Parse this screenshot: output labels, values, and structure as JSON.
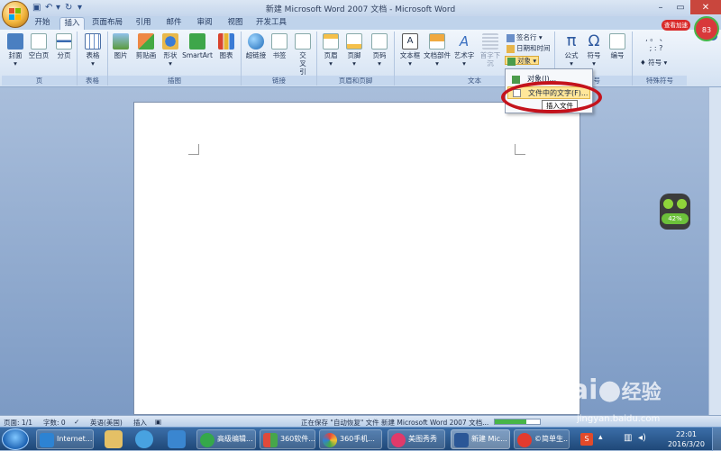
{
  "titlebar": {
    "title": "新建 Microsoft Word 2007 文档 - Microsoft Word",
    "badge_label": "查看加速",
    "badge_count": "83"
  },
  "tabs": [
    "开始",
    "插入",
    "页面布局",
    "引用",
    "邮件",
    "审阅",
    "视图",
    "开发工具"
  ],
  "ribbon": {
    "groups": {
      "pages": "页",
      "tables": "表格",
      "illustrations": "插图",
      "links": "链接",
      "header_footer": "页眉和页脚",
      "text": "文本",
      "symbols": "符号",
      "special": "特殊符号"
    },
    "buttons": {
      "cover": "封面",
      "blank": "空白页",
      "break": "分页",
      "table": "表格",
      "picture": "图片",
      "clipart": "剪贴画",
      "shapes": "形状",
      "smartart": "SmartArt",
      "chart": "图表",
      "hyperlink": "超链接",
      "bookmark": "书签",
      "crossref": "交叉引用",
      "header": "页眉",
      "footer": "页脚",
      "pagenum": "页码",
      "textbox": "文本框",
      "quickparts": "文档部件",
      "wordart": "艺术字",
      "dropcap": "首字下沉",
      "signature": "签名行",
      "datetime": "日期和时间",
      "object": "对象",
      "equation": "公式",
      "symbol": "符号",
      "number": "编号",
      "special_symbol": "符号"
    }
  },
  "object_menu": {
    "items": [
      "对象(J)...",
      "文件中的文字(F)..."
    ],
    "tooltip": "插入文件"
  },
  "mascot_percent": "42%",
  "statusbar": {
    "page": "页面: 1/1",
    "words": "字数: 0",
    "language": "英语(美国)",
    "mode": "插入",
    "saving": "正在保存 \"自动恢复\" 文件 新建 Microsoft Word 2007 文档...",
    "progress": 0.7
  },
  "taskbar": {
    "items": [
      "Internet...",
      "高级编辑...",
      "360软件...",
      "360手机...",
      "美图秀秀",
      "新建 Mic...",
      "©简单生..."
    ],
    "time": "22:01",
    "date": "2016/3/20"
  },
  "watermark": {
    "brand": "Bai",
    "brand2": "经验",
    "url": "jingyan.baidu.com"
  }
}
